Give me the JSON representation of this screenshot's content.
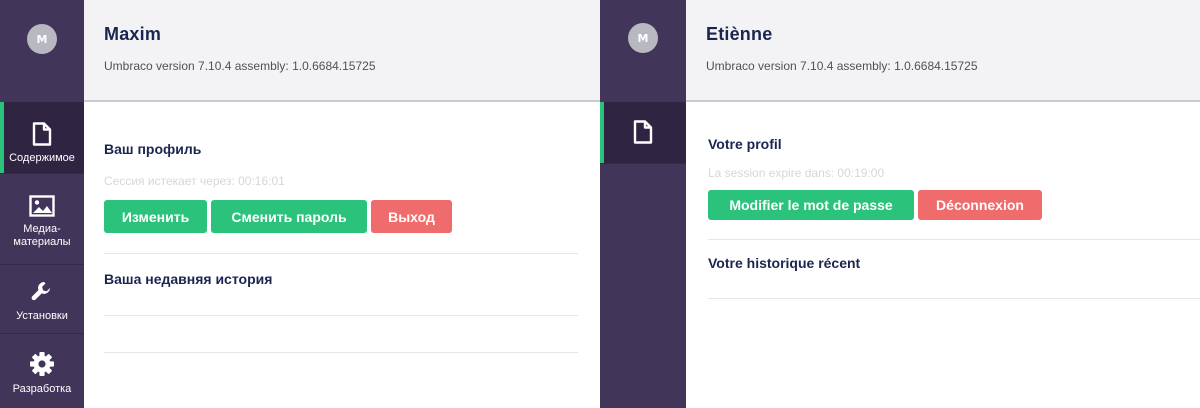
{
  "left": {
    "user": {
      "initial": "M",
      "name": "Maxim",
      "version": "Umbraco version 7.10.4 assembly: 1.0.6684.15725"
    },
    "sections": [
      {
        "icon": "document-icon",
        "label": "Содержимое",
        "active": true
      },
      {
        "icon": "image-icon",
        "label": "Медиа-\nматериалы",
        "active": false
      },
      {
        "icon": "wrench-icon",
        "label": "Установки",
        "active": false
      },
      {
        "icon": "gear-icon",
        "label": "Разработка",
        "active": false
      }
    ],
    "profile": {
      "title": "Ваш профиль",
      "session": "Сессия истекает через: 00:16:01",
      "buttons": {
        "edit": "Изменить",
        "change_password": "Сменить пароль",
        "logout": "Выход"
      },
      "history_title": "Ваша недавняя история"
    }
  },
  "right": {
    "user": {
      "initial": "M",
      "name": "Etiènne",
      "version": "Umbraco version 7.10.4 assembly: 1.0.6684.15725"
    },
    "sections": [
      {
        "icon": "document-icon",
        "label": "",
        "active": true
      }
    ],
    "profile": {
      "title": "Votre profil",
      "session": "La session expire dans: 00:19:00",
      "buttons": {
        "change_password": "Modifier le mot de passe",
        "logout": "Déconnexion"
      },
      "history_title": "Votre historique récent"
    }
  },
  "colors": {
    "sidebar": "#413659",
    "active_indicator": "#2bc37c",
    "success": "#2bc37c",
    "danger": "#f06b6b"
  }
}
